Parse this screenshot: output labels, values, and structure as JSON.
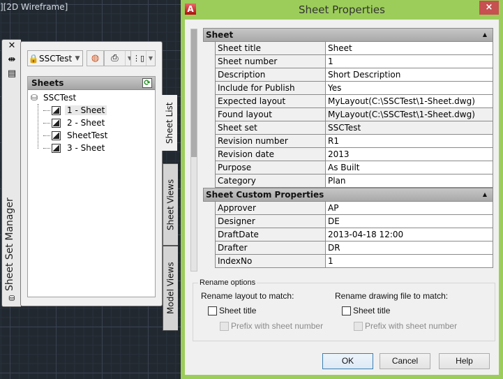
{
  "viewport": {
    "label": "][2D Wireframe]"
  },
  "ssm": {
    "title": "Sheet Set Manager",
    "side_icons": [
      "close-icon",
      "autohide-icon",
      "properties-icon"
    ],
    "sheet_set_combo": "SSCTest",
    "sheets_panel": {
      "header": "Sheets",
      "root": "SSCTest",
      "items": [
        {
          "label": "1 - Sheet",
          "selected": true
        },
        {
          "label": "2 - Sheet",
          "selected": false
        },
        {
          "label": "SheetTest",
          "selected": false
        },
        {
          "label": "3 - Sheet",
          "selected": false
        }
      ]
    },
    "tabs": [
      "Sheet List",
      "Sheet Views",
      "Model Views"
    ]
  },
  "dialog": {
    "title": "Sheet Properties",
    "close_label": "×",
    "scroll_fraction_visible": 0.53,
    "categories": [
      {
        "name": "Sheet",
        "rows": [
          {
            "name": "Sheet title",
            "value": "Sheet",
            "readonly": false
          },
          {
            "name": "Sheet number",
            "value": "1",
            "readonly": false
          },
          {
            "name": "Description",
            "value": "Short Description",
            "readonly": false
          },
          {
            "name": "Include for Publish",
            "value": "Yes",
            "readonly": false
          },
          {
            "name": "Expected layout",
            "value": "MyLayout(C:\\SSCTest\\1-Sheet.dwg)",
            "readonly": false
          },
          {
            "name": "Found layout",
            "value": "MyLayout(C:\\SSCTest\\1-Sheet.dwg)",
            "readonly": true
          },
          {
            "name": "Sheet set",
            "value": "SSCTest",
            "readonly": true
          },
          {
            "name": "Revision number",
            "value": "R1",
            "readonly": false
          },
          {
            "name": "Revision date",
            "value": "2013",
            "readonly": false
          },
          {
            "name": "Purpose",
            "value": "As Built",
            "readonly": false
          },
          {
            "name": "Category",
            "value": "Plan",
            "readonly": false
          }
        ]
      },
      {
        "name": "Sheet Custom Properties",
        "rows": [
          {
            "name": "Approver",
            "value": "AP",
            "readonly": false
          },
          {
            "name": "Designer",
            "value": "DE",
            "readonly": false
          },
          {
            "name": "DraftDate",
            "value": "2013-04-18 12:00",
            "readonly": false
          },
          {
            "name": "Drafter",
            "value": "DR",
            "readonly": false
          },
          {
            "name": "IndexNo",
            "value": "1",
            "readonly": false
          }
        ]
      }
    ],
    "rename_options": {
      "legend": "Rename options",
      "layout_label": "Rename layout to match:",
      "drawing_label": "Rename drawing file to match:",
      "sheet_title_label": "Sheet title",
      "prefix_label": "Prefix with sheet number",
      "layout_sheet_title_checked": false,
      "drawing_sheet_title_checked": false
    },
    "buttons": {
      "ok": "OK",
      "cancel": "Cancel",
      "help": "Help"
    }
  },
  "colors": {
    "titlebar": "#9ccd5a",
    "close": "#c75050",
    "canvas": "#212830"
  }
}
